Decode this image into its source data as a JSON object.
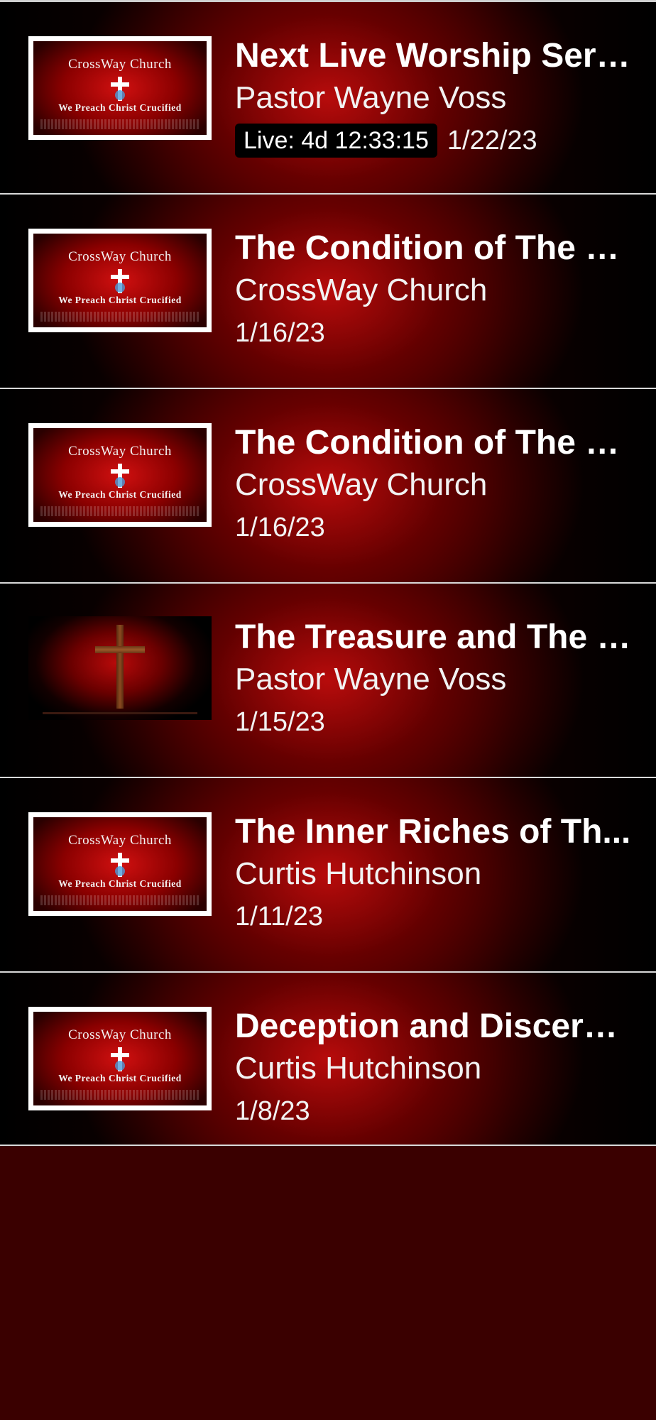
{
  "logo": {
    "top": "CrossWay Church",
    "bottom": "We Preach Christ Crucified"
  },
  "items": [
    {
      "title": "Next Live Worship Serv...",
      "subtitle": "Pastor Wayne Voss",
      "live": "Live: 4d 12:33:15",
      "date": "1/22/23",
      "thumb": "logo"
    },
    {
      "title": "The Condition of The C...",
      "subtitle": "CrossWay Church",
      "date": "1/16/23",
      "thumb": "logo"
    },
    {
      "title": "The Condition of The C...",
      "subtitle": "CrossWay Church",
      "date": "1/16/23",
      "thumb": "logo"
    },
    {
      "title": "The Treasure and The T...",
      "subtitle": "Pastor Wayne Voss",
      "date": "1/15/23",
      "thumb": "cross"
    },
    {
      "title": "The Inner Riches of Th...",
      "subtitle": "Curtis Hutchinson",
      "date": "1/11/23",
      "thumb": "logo"
    },
    {
      "title": "Deception and Discern...",
      "subtitle": "Curtis Hutchinson",
      "date": "1/8/23",
      "thumb": "logo"
    }
  ],
  "colors": {
    "background": "#3a0000",
    "accent_red": "#d01010",
    "divider": "#d9d9d9",
    "text": "#ffffff"
  }
}
